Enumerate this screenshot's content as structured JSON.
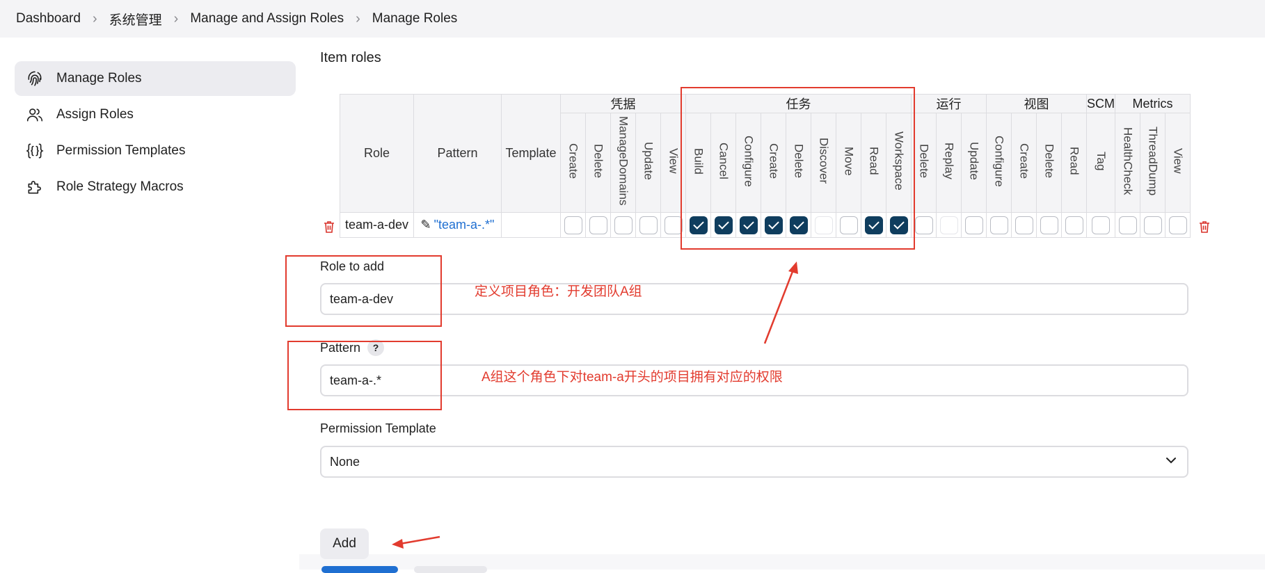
{
  "breadcrumb": [
    "Dashboard",
    "系统管理",
    "Manage and Assign Roles",
    "Manage Roles"
  ],
  "sidebar": {
    "items": [
      {
        "label": "Manage Roles",
        "icon": "fingerprint-icon",
        "active": true
      },
      {
        "label": "Assign Roles",
        "icon": "users-icon",
        "active": false
      },
      {
        "label": "Permission Templates",
        "icon": "braces-icon",
        "active": false
      },
      {
        "label": "Role Strategy Macros",
        "icon": "puzzle-icon",
        "active": false
      }
    ]
  },
  "section_title": "Item roles",
  "table": {
    "fixed_headers": {
      "role": "Role",
      "pattern": "Pattern",
      "template": "Template"
    },
    "groups": [
      {
        "name": "凭据",
        "permissions": [
          "Create",
          "Delete",
          "ManageDomains",
          "Update",
          "View"
        ]
      },
      {
        "name": "任务",
        "permissions": [
          "Build",
          "Cancel",
          "Configure",
          "Create",
          "Delete",
          "Discover",
          "Move",
          "Read",
          "Workspace"
        ]
      },
      {
        "name": "运行",
        "permissions": [
          "Delete",
          "Replay",
          "Update"
        ]
      },
      {
        "name": "视图",
        "permissions": [
          "Configure",
          "Create",
          "Delete",
          "Read"
        ]
      },
      {
        "name": "SCM",
        "permissions": [
          "Tag"
        ]
      },
      {
        "name": "Metrics",
        "permissions": [
          "HealthCheck",
          "ThreadDump",
          "View"
        ]
      }
    ],
    "rows": [
      {
        "role": "team-a-dev",
        "pattern": "\"team-a-.*\"",
        "template": "",
        "checked": [
          [
            false,
            false,
            false,
            false,
            false
          ],
          [
            true,
            true,
            true,
            true,
            true,
            false,
            false,
            true,
            true
          ],
          [
            false,
            false,
            false
          ],
          [
            false,
            false,
            false,
            false
          ],
          [
            false
          ],
          [
            false,
            false,
            false
          ]
        ]
      }
    ]
  },
  "form": {
    "role_to_add": {
      "label": "Role to add",
      "value": "team-a-dev"
    },
    "pattern": {
      "label": "Pattern",
      "help": "?",
      "value": "team-a-.*"
    },
    "permission_template": {
      "label": "Permission Template",
      "value": "None"
    },
    "add_label": "Add"
  },
  "annotations": {
    "role_note": "定义项目角色：开发团队A组",
    "pattern_note": "A组这个角色下对team-a开头的项目拥有对应的权限"
  },
  "colors": {
    "accent": "#0f3d5e",
    "link": "#1f6fd1",
    "annotation": "#e23b2e",
    "delete": "#d8322a"
  }
}
